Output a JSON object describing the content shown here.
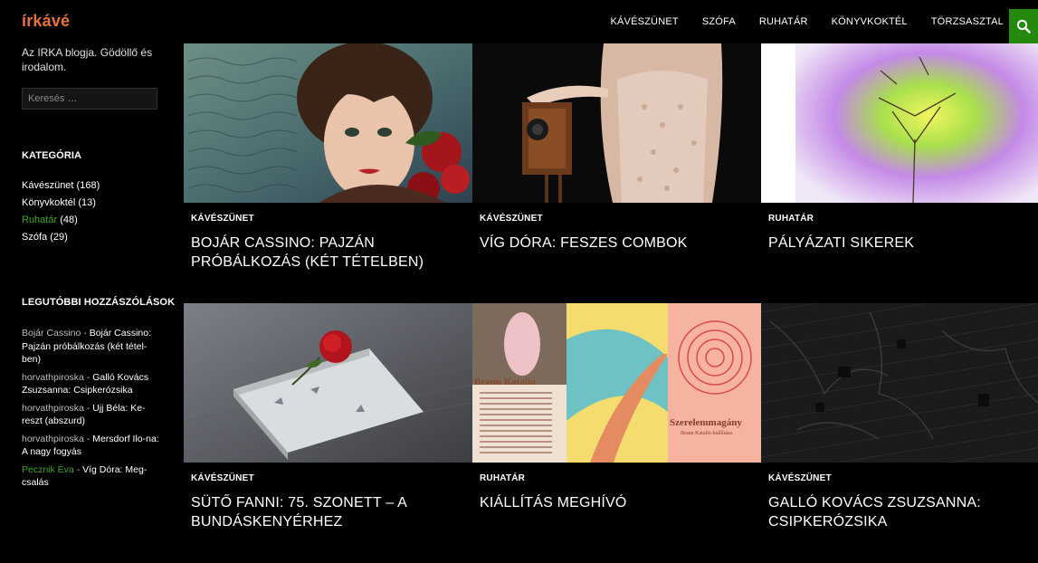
{
  "site": {
    "title": "írkávé",
    "description": "Az IRKA blogja. Gödöllő és irodalom."
  },
  "nav": {
    "items": [
      "KÁVÉSZÜNET",
      "SZÓFA",
      "RUHATÁR",
      "KÖNYVKOKTÉL",
      "TÖRZSASZTAL"
    ]
  },
  "search": {
    "placeholder": "Keresés …"
  },
  "categories": {
    "title": "KATEGÓRIA",
    "items": [
      {
        "label": "Kávészünet",
        "count": "(168)"
      },
      {
        "label": "Könyvkoktél",
        "count": "(13)"
      },
      {
        "label": "Ruhatár",
        "count": "(48)"
      },
      {
        "label": "Szófa",
        "count": "(29)"
      }
    ]
  },
  "recent_comments": {
    "title": "LEGUTÓBBI HOZZÁSZÓLÁSOK",
    "items": [
      {
        "author": "Bojár Cassino",
        "separator": " - ",
        "post": "Bojár Cassino: Pajzán próbálkozás (két tétel-ben)"
      },
      {
        "author": "horvathpiroska",
        "separator": " - ",
        "post": "Galló Kovács Zsuzsanna: Csipkerózsika"
      },
      {
        "author": "horvathpiroska",
        "separator": " - ",
        "post": "Ujj Béla: Ke-reszt (abszurd)"
      },
      {
        "author": "horvathpiroska",
        "separator": " - ",
        "post": "Mersdorf Ilo-na: A nagy fogyás"
      },
      {
        "author": "Pecznik Éva",
        "separator": " - ",
        "post": "Víg Dóra: Meg-csalás"
      }
    ]
  },
  "posts": [
    {
      "category": "KÁVÉSZÜNET",
      "title": "BOJÁR CASSINO: PAJZÁN PRÓBÁLKOZÁS (KÉT TÉTELBEN)"
    },
    {
      "category": "KÁVÉSZÜNET",
      "title": "VÍG DÓRA: FESZES COMBOK"
    },
    {
      "category": "RUHATÁR",
      "title": "PÁLYÁZATI SIKEREK"
    },
    {
      "category": "KÁVÉSZÜNET",
      "title": "SÜTŐ FANNI: 75. SZONETT – A BUNDÁSKENYÉRHEZ"
    },
    {
      "category": "RUHATÁR",
      "title": "KIÁLLÍTÁS MEGHÍVÓ"
    },
    {
      "category": "KÁVÉSZÜNET",
      "title": "GALLÓ KOVÁCS ZSUZSANNA: CSIPKERÓZSIKA"
    }
  ],
  "images": {
    "poster_title": "Szerelemmagány",
    "poster_subtitle": "Braun Katalin kiállítása",
    "poster_name": "Braun Katalin"
  },
  "colors": {
    "accent": "#24890d",
    "title": "#e8743c",
    "active": "#41a62a"
  }
}
